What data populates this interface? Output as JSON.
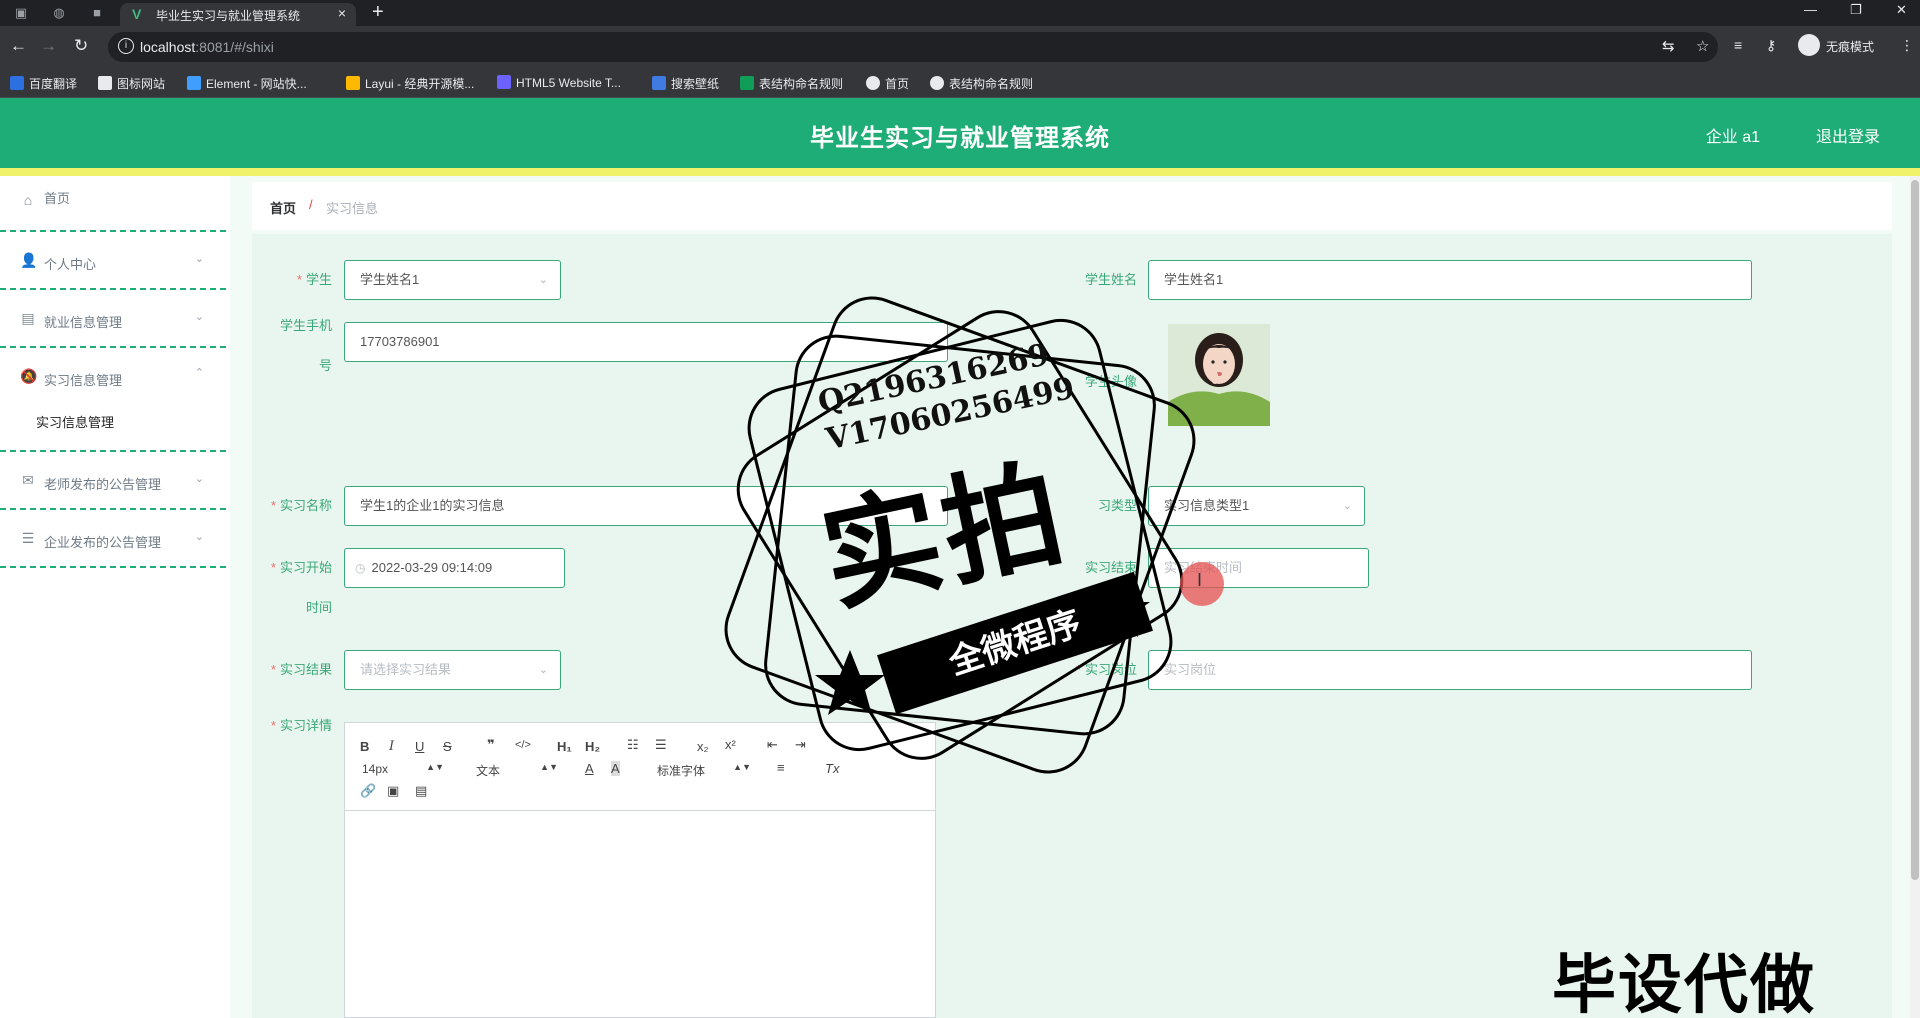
{
  "browser": {
    "tab_title": "毕业生实习与就业管理系统",
    "url_host": "localhost",
    "url_rest": ":8081/#/shixi",
    "profile_label": "无痕模式",
    "bookmarks": [
      {
        "label": "百度翻译",
        "color": "#2b6fe0"
      },
      {
        "label": "图标网站",
        "color": "#ffffff"
      },
      {
        "label": "Element - 网站快...",
        "color": "#409eff"
      },
      {
        "label": "Layui - 经典开源模...",
        "color": "#ffb800"
      },
      {
        "label": "HTML5 Website T...",
        "color": "#6c63ff"
      },
      {
        "label": "搜索壁纸",
        "color": "#3f7be0"
      },
      {
        "label": "表结构命名规则",
        "color": "#0f9d58"
      },
      {
        "label": "首页",
        "color": "#e8eaed"
      },
      {
        "label": "表结构命名规则",
        "color": "#e8eaed"
      }
    ]
  },
  "header": {
    "title": "毕业生实习与就业管理系统",
    "user": "企业 a1",
    "logout": "退出登录",
    "bg_color": "#1fad77",
    "accent_color": "#f0f36a"
  },
  "sidebar": {
    "items": [
      {
        "label": "首页",
        "icon": "home-icon"
      },
      {
        "label": "个人中心",
        "icon": "user-icon"
      },
      {
        "label": "就业信息管理",
        "icon": "clipboard-icon"
      },
      {
        "label": "实习信息管理",
        "icon": "bell-icon"
      },
      {
        "label": "实习信息管理",
        "icon": ""
      },
      {
        "label": "老师发布的公告管理",
        "icon": "mail-icon"
      },
      {
        "label": "企业发布的公告管理",
        "icon": "sliders-icon"
      }
    ]
  },
  "breadcrumb": {
    "home": "首页",
    "sep": "/",
    "current": "实习信息"
  },
  "form": {
    "student_label": "学生",
    "student_value": "学生姓名1",
    "student_name_label": "学生姓名",
    "student_name_value": "学生姓名1",
    "phone_label_1": "学生手机",
    "phone_label_2": "号",
    "phone_value": "17703786901",
    "avatar_label": "学生头像",
    "intern_name_label": "实习名称",
    "intern_name_value": "学生1的企业1的实习信息",
    "intern_type_label": "习类型",
    "intern_type_value": "实习信息类型1",
    "start_label_1": "实习开始",
    "start_label_2": "时间",
    "start_value": "2022-03-29 09:14:09",
    "end_label": "实习结束",
    "end_placeholder": "实习结束时间",
    "result_label": "实习结果",
    "result_placeholder": "请选择实习结果",
    "post_label": "实习岗位",
    "post_placeholder": "实习岗位",
    "detail_label": "实习详情"
  },
  "editor": {
    "font_size": "14px",
    "text_style": "文本",
    "font_family": "标准字体"
  },
  "watermark": {
    "stamp_line1": "Q2196316269",
    "stamp_line2": "V17060256499",
    "stamp_big": "实拍",
    "stamp_banner": "全微程序",
    "bottom_text": "毕设代做"
  }
}
